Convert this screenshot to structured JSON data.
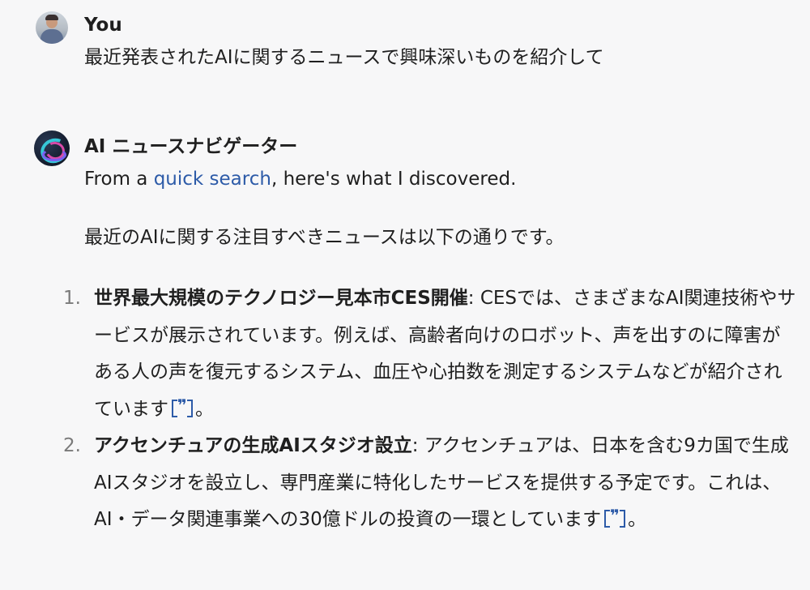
{
  "user_message": {
    "sender": "You",
    "text": "最近発表されたAIに関するニュースで興味深いものを紹介して"
  },
  "assistant_message": {
    "sender": "AI ニュースナビゲーター",
    "intro_prefix": "From a ",
    "intro_link": "quick search",
    "intro_suffix": ", here's what I discovered.",
    "lead": "最近のAIに関する注目すべきニュースは以下の通りです。",
    "items": [
      {
        "number": "1.",
        "title": "世界最大規模のテクノロジー見本市CES開催",
        "body": ": CESでは、さまざまなAI関連技術やサービスが展示されています。例えば、高齢者向けのロボット、声を出すのに障害がある人の声を復元するシステム、血圧や心拍数を測定するシステムなどが紹介されています",
        "end": "。"
      },
      {
        "number": "2.",
        "title": "アクセンチュアの生成AIスタジオ設立",
        "body": ": アクセンチュアは、日本を含む9カ国で生成AIスタジオを設立し、専門産業に特化したサービスを提供する予定です。これは、AI・データ関連事業への30億ドルの投資の一環としています",
        "end": "。"
      }
    ],
    "cite_glyph": "❞"
  },
  "colors": {
    "link": "#2d5ba8",
    "background": "#f7f7f8",
    "text": "#1f1f1f",
    "list_number": "#7a7a7a"
  }
}
